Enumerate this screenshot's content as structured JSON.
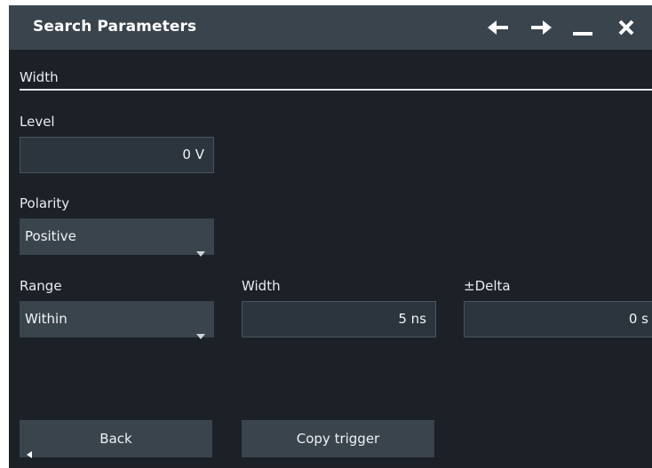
{
  "dialog": {
    "title": "Search Parameters",
    "controls": {
      "back_icon": "arrow-left-icon",
      "forward_icon": "arrow-right-icon",
      "minimize_icon": "minimize-icon",
      "close_icon": "close-icon"
    }
  },
  "section": {
    "label": "Width"
  },
  "level": {
    "label": "Level",
    "value": "0 V"
  },
  "polarity": {
    "label": "Polarity",
    "value": "Positive"
  },
  "range": {
    "label": "Range",
    "value": "Within"
  },
  "width": {
    "label": "Width",
    "value": "5 ns"
  },
  "delta": {
    "label": "±Delta",
    "value": "0 s"
  },
  "footer": {
    "back_label": "Back",
    "copy_trigger_label": "Copy trigger"
  },
  "colors": {
    "background": "#1b2127",
    "titlebar": "#3a444d",
    "field": "#2c353d",
    "text": "#e9ecef"
  }
}
